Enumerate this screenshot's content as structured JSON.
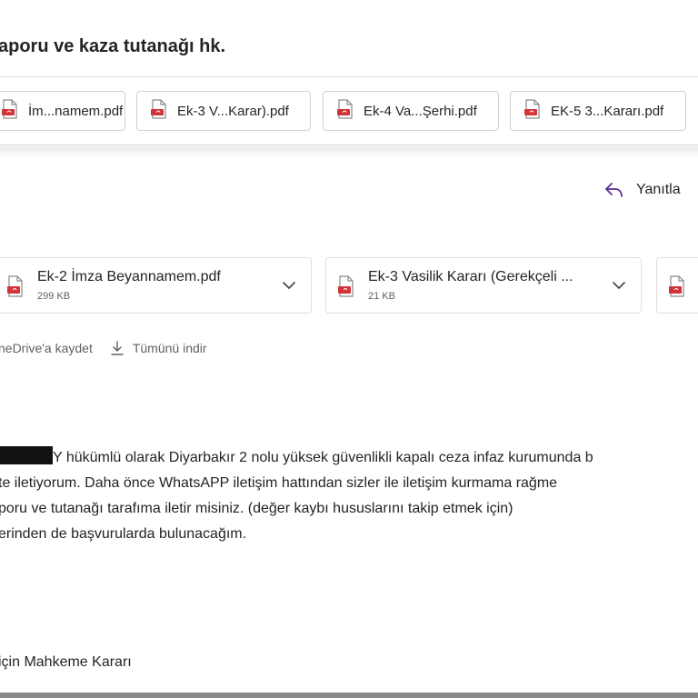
{
  "email": {
    "subject": "aporu ve kaza tutanağı hk.",
    "top_attachments": [
      {
        "label": "İm...namem.pdf"
      },
      {
        "label": "Ek-3 V...Karar).pdf"
      },
      {
        "label": "Ek-4 Va...Şerhi.pdf"
      },
      {
        "label": "EK-5 3...Kararı.pdf"
      }
    ],
    "reply_label": "Yanıtla",
    "attachments": [
      {
        "name": "Ek-2 İmza Beyannamem.pdf",
        "size": "299 KB"
      },
      {
        "name": "Ek-3 Vasilik Kararı (Gerekçeli ...",
        "size": "21 KB"
      }
    ],
    "actions": {
      "onedrive": "neDrive'a kaydet",
      "download_all": "Tümünü indir"
    },
    "body_lines": [
      "Y hükümlü olarak Diyarbakır 2 nolu yüksek güvenlikli kapalı ceza infaz kurumunda b",
      "te iletiyorum. Daha önce WhatsAPP iletişim hattından sizler ile iletişim kurmama rağme",
      "poru ve tutanağı tarafıma iletir misiniz. (değer kaybı hususlarını takip etmek için)",
      "erinden de başvurularda bulunacağım."
    ],
    "signature_line": " için Mahkeme Kararı"
  },
  "colors": {
    "accent": "#5c2d91",
    "pdf_red": "#d13438",
    "text": "#242424",
    "muted": "#616161",
    "border": "#d1d1d1"
  },
  "icons": {
    "pdf": "pdf-file-icon",
    "reply": "reply-arrow-icon",
    "chevron": "chevron-down-icon",
    "download": "download-icon"
  }
}
